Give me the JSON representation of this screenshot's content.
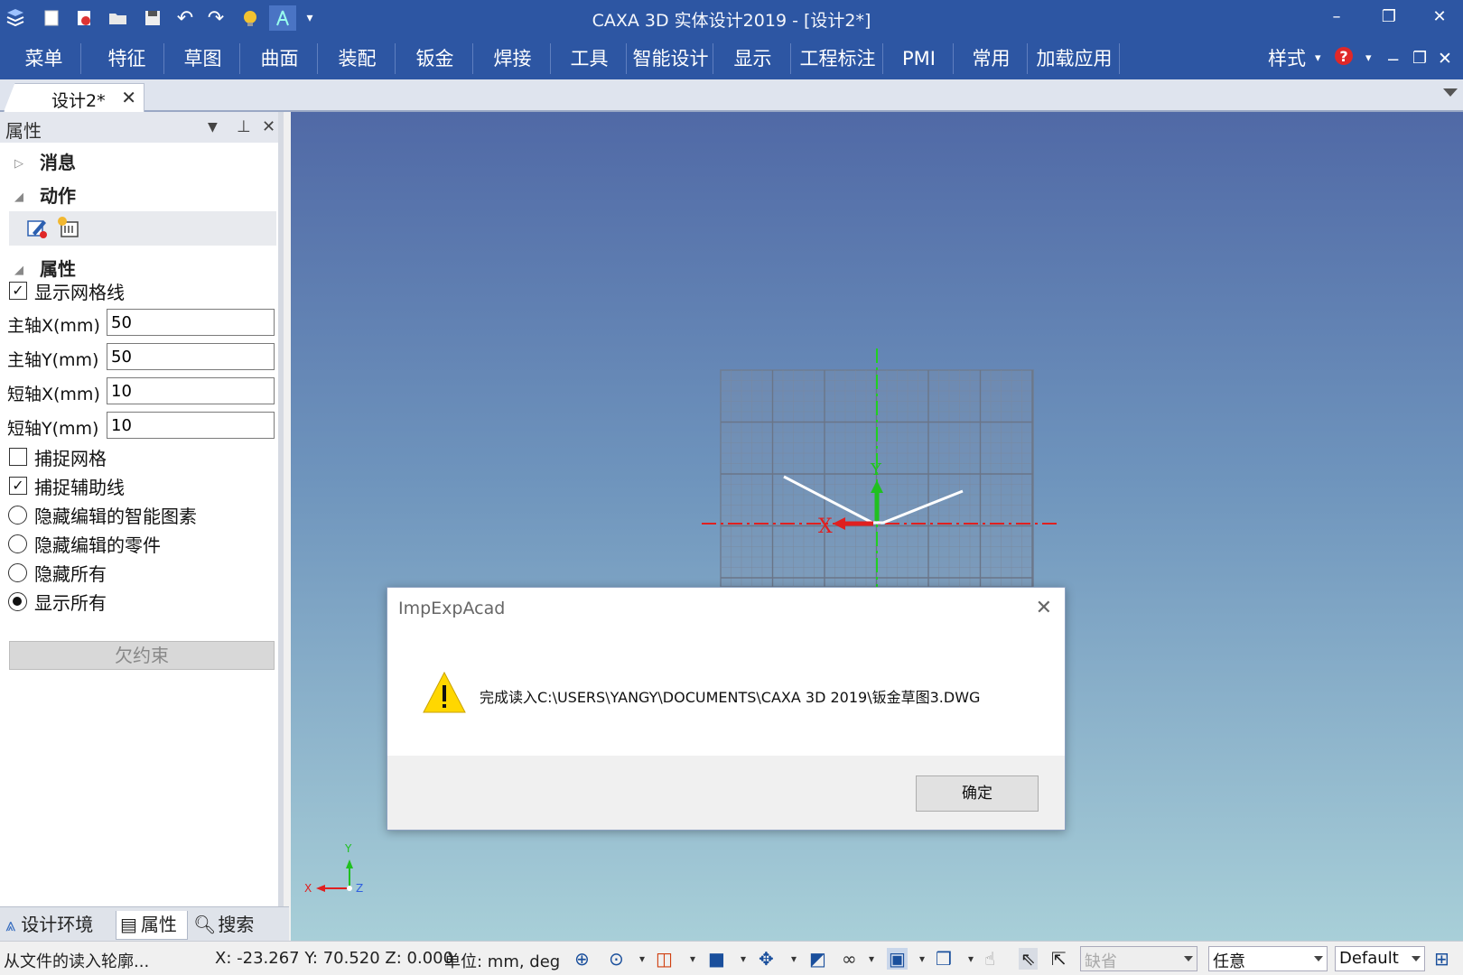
{
  "titlebar": {
    "title": "CAXA 3D 实体设计2019 - [设计2*]",
    "quick_access": [
      "app-logo-icon",
      "new-file-icon",
      "open-file-icon",
      "folder-icon",
      "save-icon",
      "undo-icon",
      "redo-icon",
      "bulb-icon",
      "design-tree-icon",
      "dropdown-icon"
    ]
  },
  "ribbon": {
    "tabs": [
      "菜单",
      "特征",
      "草图",
      "曲面",
      "装配",
      "钣金",
      "焊接",
      "工具",
      "智能设计",
      "显示",
      "工程标注",
      "PMI",
      "常用",
      "加载应用"
    ],
    "style_label": "样式"
  },
  "document": {
    "tab_label": "设计2*"
  },
  "panel": {
    "title": "属性",
    "sections": {
      "message": "消息",
      "action": "动作",
      "properties": "属性"
    },
    "show_grid": "显示网格线",
    "fields": [
      {
        "label": "主轴X(mm)",
        "value": "50"
      },
      {
        "label": "主轴Y(mm)",
        "value": "50"
      },
      {
        "label": "短轴X(mm)",
        "value": "10"
      },
      {
        "label": "短轴Y(mm)",
        "value": "10"
      }
    ],
    "snap_grid": "捕捉网格",
    "snap_aux": "捕捉辅助线",
    "radios": [
      "隐藏编辑的智能图素",
      "隐藏编辑的零件",
      "隐藏所有",
      "显示所有"
    ],
    "underconstrained_button": "欠约束",
    "checkbox_checked": {
      "show_grid": true,
      "snap_grid": false,
      "snap_aux": true
    },
    "selected_radio": 3
  },
  "bottom_tabs": [
    "设计环境",
    "属性",
    "搜索"
  ],
  "viewport": {
    "axis_x": "X",
    "axis_y": "Y",
    "axis_z": "Z"
  },
  "dialog": {
    "title": "ImpExpAcad",
    "message": "完成读入C:\\USERS\\YANGY\\DOCUMENTS\\CAXA 3D 2019\\钣金草图3.DWG",
    "ok_label": "确定"
  },
  "status": {
    "hint": "从文件的读入轮廓...",
    "coords": "X: -23.267 Y: 70.520 Z: 0.000",
    "units": "单位: mm, deg",
    "combo_default_missing": "缺省",
    "combo_any": "任意",
    "combo_style": "Default"
  },
  "colors": {
    "titlebar": "#2d56a3",
    "warning": "#ffd700",
    "x_axis": "#e02020",
    "y_axis": "#20c020"
  }
}
